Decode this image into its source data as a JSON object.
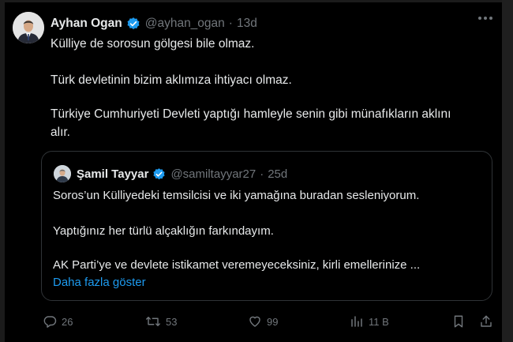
{
  "tweet": {
    "author_name": "Ayhan Ogan",
    "author_handle": "@ayhan_ogan",
    "time": "13d",
    "lines": [
      "Külliye de sorosun gölgesi bile olmaz.",
      "Türk devletinin bizim aklımıza ihtiyacı olmaz.",
      "Türkiye Cumhuriyeti Devleti yaptığı hamleyle senin gibi münafıkların aklını",
      "alır."
    ]
  },
  "quote": {
    "author_name": "Şamil Tayyar",
    "author_handle": "@samiltayyar27",
    "time": "25d",
    "lines": [
      "Soros’un Külliyedeki temsilcisi ve iki yamağına buradan sesleniyorum.",
      "Yaptığınız her türlü alçaklığın farkındayım.",
      "AK Parti’ye ve devlete istikamet veremeyeceksiniz, kirli emellerinize ..."
    ],
    "show_more": "Daha fazla göster"
  },
  "actions": {
    "replies": "26",
    "retweets": "53",
    "likes": "99",
    "views": "11 B"
  },
  "colors": {
    "background": "#000000",
    "text": "#e7e9ea",
    "muted": "#71767b",
    "accent": "#1d9bf0",
    "border": "#2f3336"
  },
  "icons": [
    "verified-badge-icon",
    "more-options-icon",
    "reply-icon",
    "retweet-icon",
    "like-icon",
    "views-icon",
    "bookmark-icon",
    "share-icon"
  ]
}
